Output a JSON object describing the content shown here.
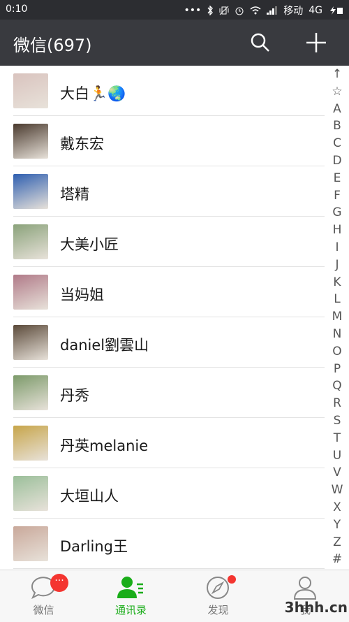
{
  "status_bar": {
    "time": "0:10",
    "carrier": "移动",
    "network": "4G",
    "icons": [
      "dots-icon",
      "bluetooth-icon",
      "vibrate-icon",
      "alarm-icon",
      "wifi-icon",
      "signal-icon",
      "battery-icon"
    ]
  },
  "header": {
    "title": "微信(697)",
    "icons": [
      "search-icon",
      "plus-icon"
    ]
  },
  "contacts": [
    {
      "name": "大白🏃🌏",
      "avatar_color": "#d9c3be"
    },
    {
      "name": "戴东宏",
      "avatar_color": "#4a3a2e"
    },
    {
      "name": "塔精",
      "avatar_color": "#2f5fb0"
    },
    {
      "name": "大美小匠",
      "avatar_color": "#8aa27a"
    },
    {
      "name": "当妈姐",
      "avatar_color": "#b07a88"
    },
    {
      "name": "daniel劉雲山",
      "avatar_color": "#5b4a3a"
    },
    {
      "name": "丹秀",
      "avatar_color": "#7c9a6a"
    },
    {
      "name": "丹英melanie",
      "avatar_color": "#c7a54a"
    },
    {
      "name": "大垣山人",
      "avatar_color": "#9bbf9a"
    },
    {
      "name": "Darling王",
      "avatar_color": "#c9a89a"
    }
  ],
  "index_letters": [
    "↑",
    "☆",
    "A",
    "B",
    "C",
    "D",
    "E",
    "F",
    "G",
    "H",
    "I",
    "J",
    "K",
    "L",
    "M",
    "N",
    "O",
    "P",
    "Q",
    "R",
    "S",
    "T",
    "U",
    "V",
    "W",
    "X",
    "Y",
    "Z",
    "#"
  ],
  "tabs": [
    {
      "label": "微信",
      "icon": "chat-icon",
      "badge": "···",
      "active": false
    },
    {
      "label": "通讯录",
      "icon": "contacts-icon",
      "active": true
    },
    {
      "label": "发现",
      "icon": "compass-icon",
      "dot": true,
      "active": false
    },
    {
      "label": "我",
      "icon": "person-icon",
      "active": false
    }
  ],
  "watermark": "3hhh.cn",
  "colors": {
    "accent": "#1aad19",
    "header": "#393a3f",
    "badge": "#f43530"
  }
}
